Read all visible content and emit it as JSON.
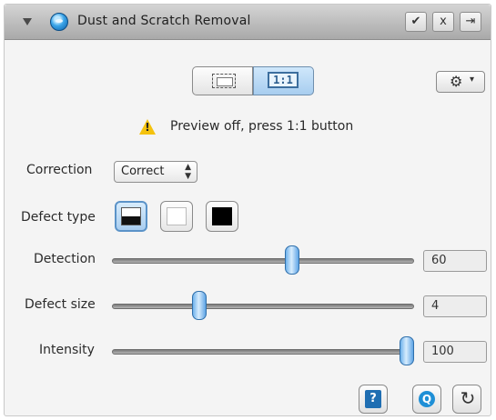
{
  "titlebar": {
    "title": "Dust and Scratch Removal",
    "check_glyph": "✔",
    "close_glyph": "x",
    "menu_glyph": "⇥"
  },
  "preview": {
    "one_to_one_label": "1:1",
    "message": "Preview off, press 1:1 button"
  },
  "correction": {
    "label": "Correction",
    "value": "Correct"
  },
  "defect_type": {
    "label": "Defect type",
    "options": [
      "dark-and-light",
      "light",
      "dark"
    ],
    "selected": "dark-and-light"
  },
  "sliders": [
    {
      "label": "Detection",
      "value": "60",
      "fraction": 0.6
    },
    {
      "label": "Defect size",
      "value": "4",
      "fraction": 0.28
    },
    {
      "label": "Intensity",
      "value": "100",
      "fraction": 1.0
    }
  ],
  "icons": {
    "disclosure": "disclosure-triangle-icon",
    "title": "dust-removal-icon",
    "gear": "gear-icon",
    "warning": "warning-icon",
    "help": "help-icon",
    "preview": "preview-icon",
    "reset": "reset-icon"
  },
  "colors": {
    "accent": "#5b93c8",
    "titlebar": "#bdbdbd",
    "warning": "#f4c20d"
  }
}
